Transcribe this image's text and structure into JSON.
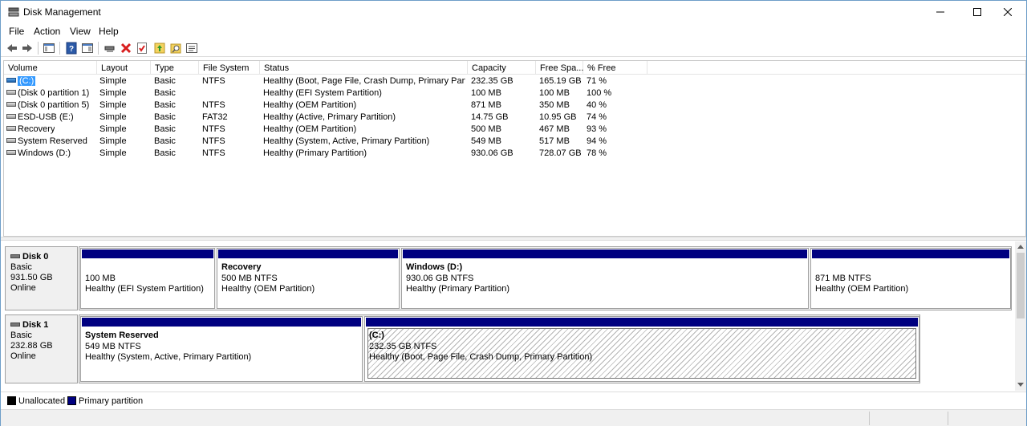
{
  "window": {
    "title": "Disk Management"
  },
  "menu": [
    "File",
    "Action",
    "View",
    "Help"
  ],
  "volume_table": {
    "columns": [
      "Volume",
      "Layout",
      "Type",
      "File System",
      "Status",
      "Capacity",
      "Free Spa...",
      "% Free"
    ],
    "rows": [
      {
        "volume": "(C:)",
        "layout": "Simple",
        "type": "Basic",
        "fs": "NTFS",
        "status": "Healthy (Boot, Page File, Crash Dump, Primary Part...",
        "capacity": "232.35 GB",
        "free": "165.19 GB",
        "pct": "71 %",
        "selected": true
      },
      {
        "volume": "(Disk 0 partition 1)",
        "layout": "Simple",
        "type": "Basic",
        "fs": "",
        "status": "Healthy (EFI System Partition)",
        "capacity": "100 MB",
        "free": "100 MB",
        "pct": "100 %"
      },
      {
        "volume": "(Disk 0 partition 5)",
        "layout": "Simple",
        "type": "Basic",
        "fs": "NTFS",
        "status": "Healthy (OEM Partition)",
        "capacity": "871 MB",
        "free": "350 MB",
        "pct": "40 %"
      },
      {
        "volume": "ESD-USB (E:)",
        "layout": "Simple",
        "type": "Basic",
        "fs": "FAT32",
        "status": "Healthy (Active, Primary Partition)",
        "capacity": "14.75 GB",
        "free": "10.95 GB",
        "pct": "74 %"
      },
      {
        "volume": "Recovery",
        "layout": "Simple",
        "type": "Basic",
        "fs": "NTFS",
        "status": "Healthy (OEM Partition)",
        "capacity": "500 MB",
        "free": "467 MB",
        "pct": "93 %"
      },
      {
        "volume": "System Reserved",
        "layout": "Simple",
        "type": "Basic",
        "fs": "NTFS",
        "status": "Healthy (System, Active, Primary Partition)",
        "capacity": "549 MB",
        "free": "517 MB",
        "pct": "94 %"
      },
      {
        "volume": "Windows (D:)",
        "layout": "Simple",
        "type": "Basic",
        "fs": "NTFS",
        "status": "Healthy (Primary Partition)",
        "capacity": "930.06 GB",
        "free": "728.07 GB",
        "pct": "78 %"
      }
    ]
  },
  "disks": [
    {
      "name": "Disk 0",
      "type": "Basic",
      "size": "931.50 GB",
      "state": "Online",
      "partitions": [
        {
          "name": "",
          "size": "100 MB",
          "status": "Healthy (EFI System Partition)"
        },
        {
          "name": "Recovery",
          "size": "500 MB NTFS",
          "status": "Healthy (OEM Partition)"
        },
        {
          "name": "Windows  (D:)",
          "size": "930.06 GB NTFS",
          "status": "Healthy (Primary Partition)"
        },
        {
          "name": "",
          "size": "871 MB NTFS",
          "status": "Healthy (OEM Partition)"
        }
      ]
    },
    {
      "name": "Disk 1",
      "type": "Basic",
      "size": "232.88 GB",
      "state": "Online",
      "partitions": [
        {
          "name": "System Reserved",
          "size": "549 MB NTFS",
          "status": "Healthy (System, Active, Primary Partition)"
        },
        {
          "name": "(C:)",
          "size": "232.35 GB NTFS",
          "status": "Healthy (Boot, Page File, Crash Dump, Primary Partition)",
          "selected": true
        }
      ]
    }
  ],
  "legend": [
    {
      "label": "Unallocated",
      "color": "#000000"
    },
    {
      "label": "Primary partition",
      "color": "#000080"
    }
  ],
  "colors": {
    "partition_bar": "#000080",
    "selection": "#3399ff"
  },
  "toolbar_icons": [
    "back-icon",
    "forward-icon",
    "show-hide-console-tree-icon",
    "help-icon",
    "properties-icon",
    "connect-icon",
    "delete-icon",
    "check-icon",
    "folder-up-icon",
    "search-folder-icon",
    "settings-list-icon"
  ]
}
